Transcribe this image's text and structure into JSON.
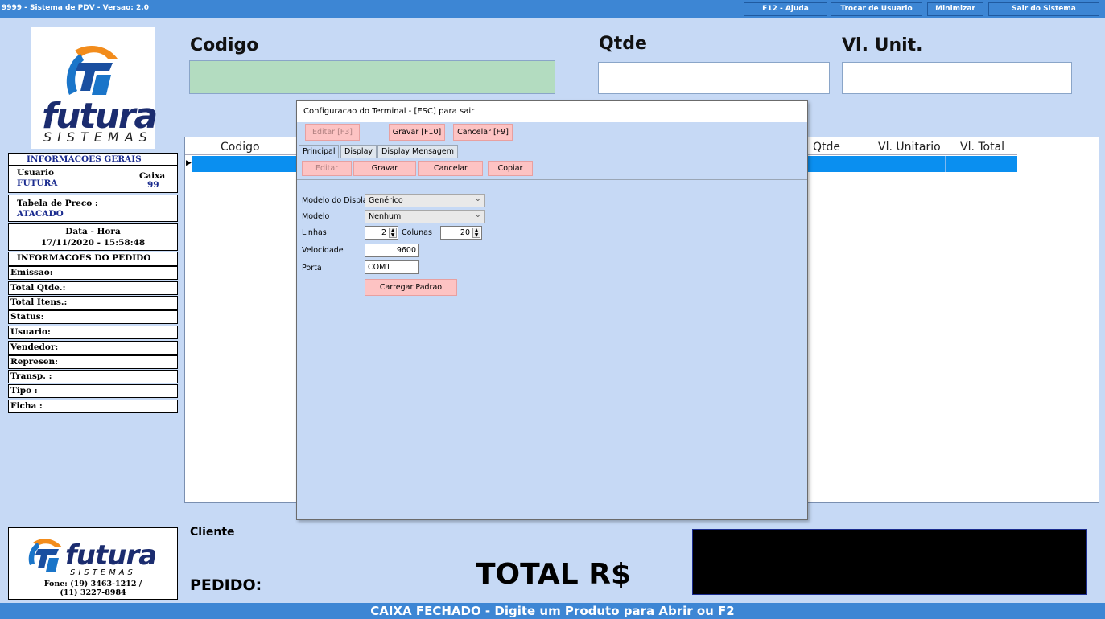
{
  "titlebar": {
    "title": "9999 - Sistema de PDV - Versao: 2.0",
    "buttons": [
      "F12 - Ajuda",
      "Trocar de Usuario",
      "Minimizar",
      "Sair do Sistema"
    ]
  },
  "logo": {
    "top_text": "futura",
    "top_sub": "SISTEMAS",
    "bottom_text": "futura",
    "bottom_sub": "SISTEMAS",
    "phone": "Fone: (19) 3463-1212 /",
    "phone2": "(11) 3227-8984"
  },
  "info": {
    "header": "INFORMACOES GERAIS",
    "usuario_label": "Usuario",
    "usuario_value": "FUTURA",
    "caixa_label": "Caixa",
    "caixa_value": "99",
    "tabela_label": "Tabela de Preco :",
    "tabela_value": "ATACADO",
    "datahora_label": "Data - Hora",
    "datahora_value": "17/11/2020 - 15:58:48",
    "pedido_header": "INFORMACOES DO PEDIDO",
    "rows": [
      "Emissao:",
      "Total Qtde.:",
      "Total Itens.:",
      "Status:",
      "Usuario:",
      "Vendedor:",
      "Represen:",
      "Transp. :",
      "Tipo :",
      "Ficha :"
    ]
  },
  "header": {
    "codigo": "Codigo",
    "qtde": "Qtde",
    "vl_unit": "Vl. Unit."
  },
  "grid": {
    "columns": [
      "Codigo",
      "Qtde",
      "Vl. Unitario",
      "Vl. Total"
    ]
  },
  "bottom": {
    "cliente": "Cliente",
    "pedido": "PEDIDO:",
    "total": "TOTAL R$"
  },
  "status": "CAIXA FECHADO - Digite um Produto para Abrir ou F2",
  "dialog": {
    "title": "Configuracao do Terminal - [ESC] para sair",
    "top_buttons": [
      "Editar [F3]",
      "Gravar [F10]",
      "Cancelar [F9]"
    ],
    "tabs": [
      "Principal",
      "Display",
      "Display Mensagem"
    ],
    "sub_buttons": [
      "Editar",
      "Gravar",
      "Cancelar",
      "Copiar"
    ],
    "form": {
      "modelo_display_label": "Modelo do Display",
      "modelo_display_value": "Genérico",
      "modelo_label": "Modelo",
      "modelo_value": "Nenhum",
      "linhas_label": "Linhas",
      "linhas_value": "2",
      "colunas_label": "Colunas",
      "colunas_value": "20",
      "velocidade_label": "Velocidade",
      "velocidade_value": "9600",
      "porta_label": "Porta",
      "porta_value": "COM1",
      "carregar_button": "Carregar Padrao"
    }
  },
  "colors": {
    "titlebar": "#3d86d4",
    "background": "#c6d9f5",
    "accent_row": "#0a8ff0",
    "pink_button": "#fdc3c3",
    "codigo_field": "#b3dcc0"
  }
}
